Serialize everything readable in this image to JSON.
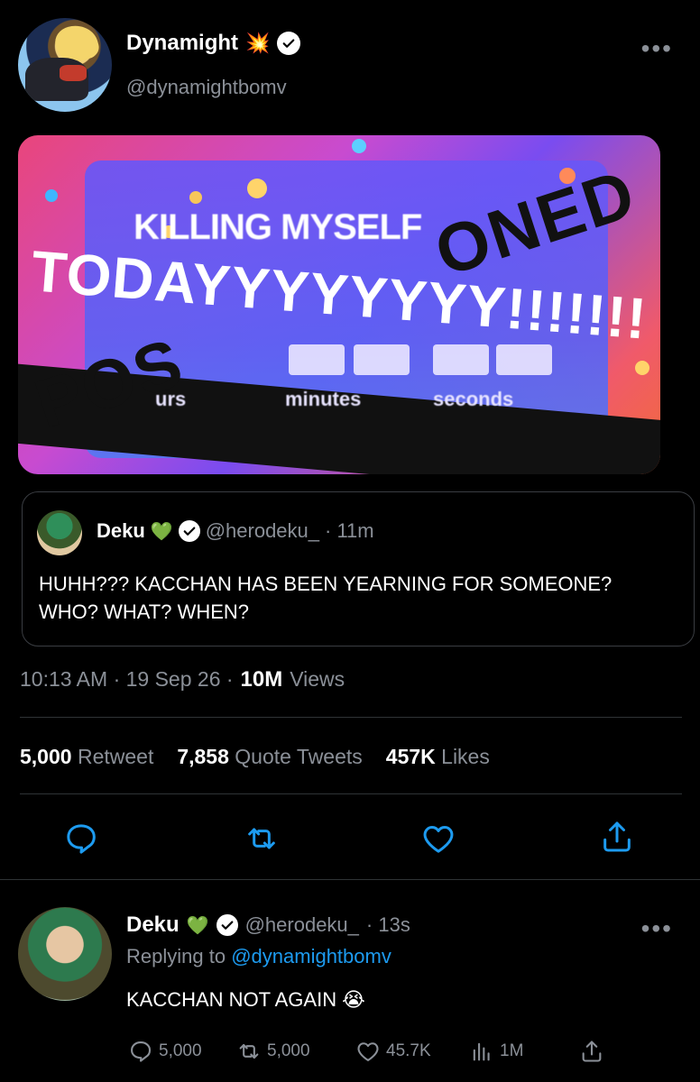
{
  "tweet": {
    "display_name": "Dynamight",
    "name_emoji": "💥",
    "handle": "@dynamightbomv",
    "more": "•••",
    "media": {
      "top_text": "KILLING MYSELF",
      "main_text": "TODAYYYYYYYY!!!!!!!",
      "stamp_top": "ONED",
      "stamp_bottom": "POS",
      "timer_labels": [
        "urs",
        "minutes",
        "seconds"
      ]
    },
    "quote": {
      "display_name": "Deku",
      "name_emoji": "💚",
      "handle": "@herodeku_",
      "time": "· 11m",
      "text": "HUHH??? KACCHAN HAS BEEN YEARNING FOR SOMEONE? WHO? WHAT? WHEN?"
    },
    "timestamp": "10:13 AM · 19 Sep 26 ·",
    "views_count": "10M",
    "views_label": "Views",
    "stats": {
      "retweets": "5,000",
      "retweets_label": "Retweet",
      "quotes": "7,858",
      "quotes_label": "Quote Tweets",
      "likes": "457K",
      "likes_label": "Likes"
    },
    "icons": [
      "reply-icon",
      "retweet-icon",
      "like-icon",
      "share-icon"
    ]
  },
  "reply": {
    "display_name": "Deku",
    "name_emoji": "💚",
    "handle": "@herodeku_",
    "time": "· 13s",
    "replying_prefix": "Replying to",
    "replying_to": "@dynamightbomv",
    "text": "KACCHAN NOT AGAIN",
    "text_emoji": "😭",
    "more": "•••",
    "stats": {
      "replies": "5,000",
      "retweets": "5,000",
      "likes": "45.7K",
      "views": "1M"
    }
  },
  "colors": {
    "background": "#000000",
    "secondary_text": "#8b9098",
    "link": "#1d9bf0",
    "divider": "#2f3336"
  }
}
